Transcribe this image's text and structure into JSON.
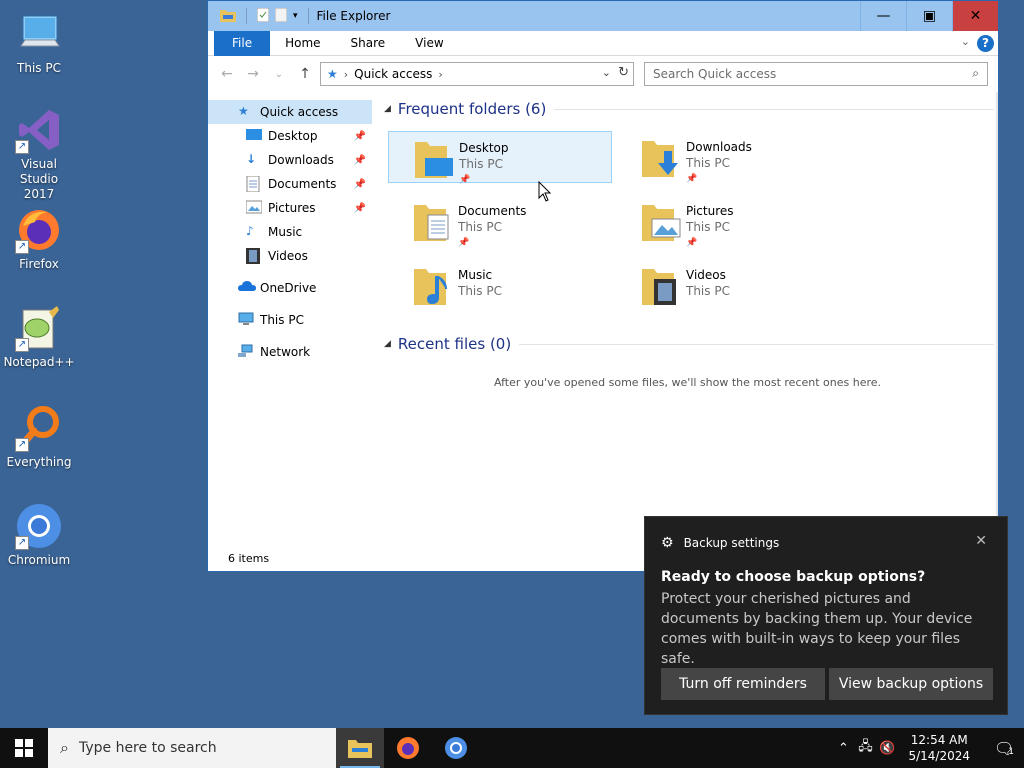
{
  "desktop": {
    "icons": [
      {
        "label": "This PC"
      },
      {
        "label": "Visual Studio 2017"
      },
      {
        "label": "Firefox"
      },
      {
        "label": "Notepad++"
      },
      {
        "label": "Everything"
      },
      {
        "label": "Chromium"
      }
    ]
  },
  "explorer": {
    "title": "File Explorer",
    "ribbon_tabs": [
      "File",
      "Home",
      "Share",
      "View"
    ],
    "address": {
      "crumb": "Quick access"
    },
    "search": {
      "placeholder": "Search Quick access"
    },
    "nav": {
      "quick_access": "Quick access",
      "pinned": [
        "Desktop",
        "Downloads",
        "Documents",
        "Pictures",
        "Music",
        "Videos"
      ],
      "onedrive": "OneDrive",
      "this_pc": "This PC",
      "network": "Network"
    },
    "frequent_header": "Frequent folders (6)",
    "recent_header": "Recent files (0)",
    "folders": [
      {
        "name": "Desktop",
        "location": "This PC"
      },
      {
        "name": "Downloads",
        "location": "This PC"
      },
      {
        "name": "Documents",
        "location": "This PC"
      },
      {
        "name": "Pictures",
        "location": "This PC"
      },
      {
        "name": "Music",
        "location": "This PC"
      },
      {
        "name": "Videos",
        "location": "This PC"
      }
    ],
    "empty_recent": "After you've opened some files, we'll show the most recent ones here.",
    "status": "6 items"
  },
  "toast": {
    "app": "Backup settings",
    "title": "Ready to choose backup options?",
    "message": "Protect your cherished pictures and documents by backing them up. Your device comes with built-in ways to keep your files safe.",
    "btn_off": "Turn off reminders",
    "btn_view": "View backup options"
  },
  "taskbar": {
    "search_placeholder": "Type here to search",
    "time": "12:54 AM",
    "date": "5/14/2024",
    "notification_count": "1"
  },
  "colors": {
    "desktop": "#3a6496",
    "accent": "#1a6fc9",
    "titlebar": "#99c4ef",
    "close": "#c94040"
  }
}
